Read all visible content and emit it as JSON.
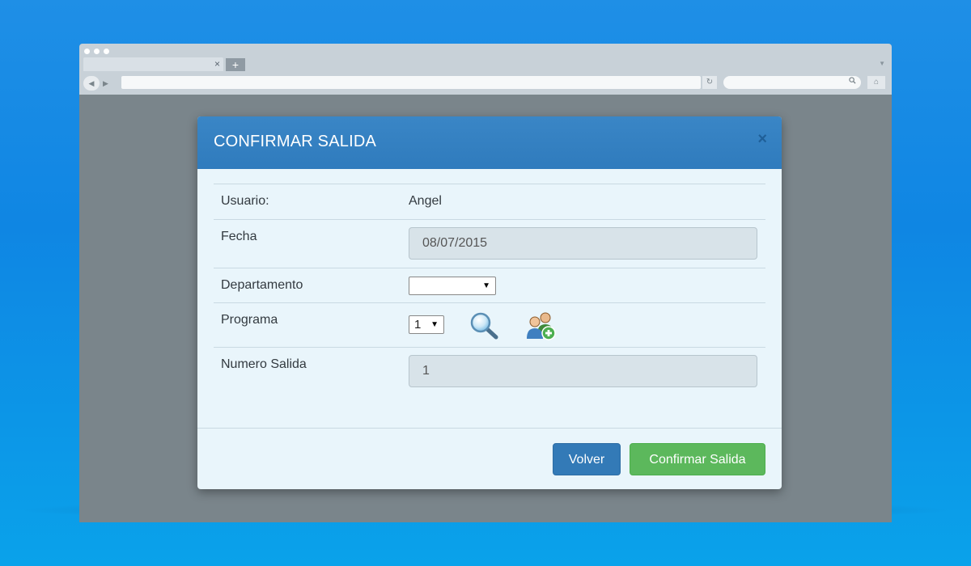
{
  "browser": {
    "tab_close": "×",
    "new_tab": "+",
    "back": "◀",
    "forward": "▶",
    "reload": "↻",
    "home": "⌂"
  },
  "modal": {
    "title": "CONFIRMAR SALIDA",
    "close": "×",
    "rows": {
      "usuario": {
        "label": "Usuario:",
        "value": "Angel"
      },
      "fecha": {
        "label": "Fecha",
        "value": "08/07/2015"
      },
      "departamento": {
        "label": "Departamento",
        "value": ""
      },
      "programa": {
        "label": "Programa",
        "value": "1"
      },
      "numero_salida": {
        "label": "Numero Salida",
        "value": "1"
      }
    },
    "icons": {
      "search": "search-icon",
      "add_user": "add-user-icon"
    },
    "buttons": {
      "back": "Volver",
      "confirm": "Confirmar Salida"
    }
  },
  "colors": {
    "header": "#2f7bbd",
    "primary_button": "#337ab7",
    "success_button": "#5cb85c",
    "modal_bg": "#e9f5fb"
  }
}
